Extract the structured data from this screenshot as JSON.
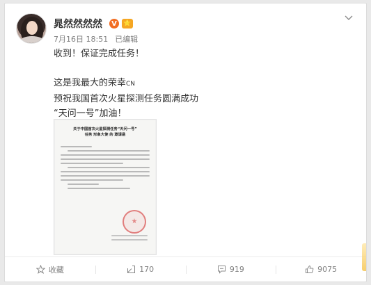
{
  "post": {
    "author": "晁然然然然",
    "verified_badge": "V",
    "member_badge": "⭐",
    "date": "7月16日 18:51",
    "edited": "已编辑",
    "content": {
      "line1": "收到！保证完成任务！",
      "line2": "这是我最大的荣幸",
      "line2_suffix": "CN",
      "line3": "预祝我国首次火星探测任务圆满成功",
      "line4": "“天问一号”加油！"
    },
    "document": {
      "title": "关于中国首次火星探测任务“天问一号”\n任务 形象大使 的 邀请函"
    }
  },
  "actions": {
    "favorite": "收藏",
    "repost": "170",
    "comment": "919",
    "like": "9075"
  },
  "icons": {
    "more": "chevron-down-icon",
    "favorite": "star-icon",
    "repost": "repost-icon",
    "comment": "comment-icon",
    "like": "thumbs-up-icon"
  },
  "colors": {
    "verified": "#f26d22",
    "member": "#f5a623",
    "muted": "#808080",
    "text": "#333333"
  }
}
